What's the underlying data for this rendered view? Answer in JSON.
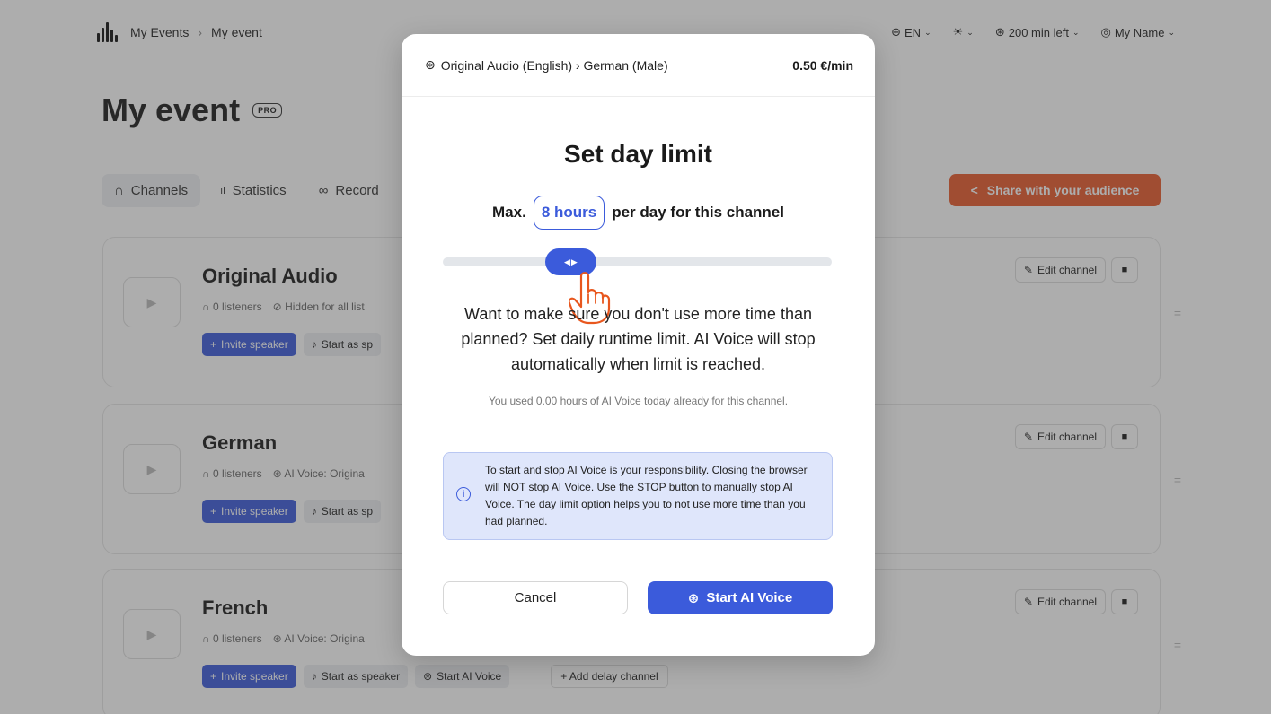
{
  "topbar": {
    "breadcrumbs": [
      "My Events",
      "My event"
    ],
    "breadcrumb_sep": "›",
    "language": "EN",
    "minutes_left": "200 min left",
    "user_name": "My Name"
  },
  "page": {
    "title": "My event",
    "pro_badge": "PRO"
  },
  "tabs": [
    {
      "label": "Channels",
      "icon": "headphones-icon",
      "active": true
    },
    {
      "label": "Statistics",
      "icon": "bar-chart-icon",
      "active": false
    },
    {
      "label": "Record",
      "icon": "recording-icon",
      "active": false
    }
  ],
  "share_button": {
    "label": "Share with your audience",
    "color": "#e85a2c"
  },
  "channels": [
    {
      "name": "Original Audio",
      "listeners": "0 listeners",
      "extra": "Hidden for all list",
      "invite_label": "Invite speaker",
      "speaker_label": "Start as sp",
      "edit_label": "Edit channel"
    },
    {
      "name": "German",
      "listeners": "0 listeners",
      "extra": "AI Voice: Origina",
      "invite_label": "Invite speaker",
      "speaker_label": "Start as sp",
      "edit_label": "Edit channel"
    },
    {
      "name": "French",
      "listeners": "0 listeners",
      "extra": "AI Voice: Origina",
      "invite_label": "Invite speaker",
      "speaker_label": "Start as speaker",
      "ai_voice_label": "Start AI Voice",
      "delay_label": "+ Add delay channel",
      "edit_label": "Edit channel"
    }
  ],
  "modal": {
    "route": "Original Audio (English) › German (Male)",
    "price": "0.50 €/min",
    "title": "Set day limit",
    "max_prefix": "Max.",
    "hours_value": "8 hours",
    "max_suffix": "per day for this channel",
    "slider_fraction": 0.33,
    "description": "Want to make sure you don't use more time than planned? Set daily runtime limit. AI Voice will stop automatically when limit is reached.",
    "used_text": "You used 0.00 hours of AI Voice today already for this channel.",
    "info_text": "To start and stop AI Voice is your responsibility. Closing the browser will NOT stop AI Voice. Use the STOP button to manually stop AI Voice. The day limit option helps you to not use more time than you had planned.",
    "cancel_label": "Cancel",
    "start_label": "Start AI Voice",
    "accent_color": "#3b5bdb"
  }
}
